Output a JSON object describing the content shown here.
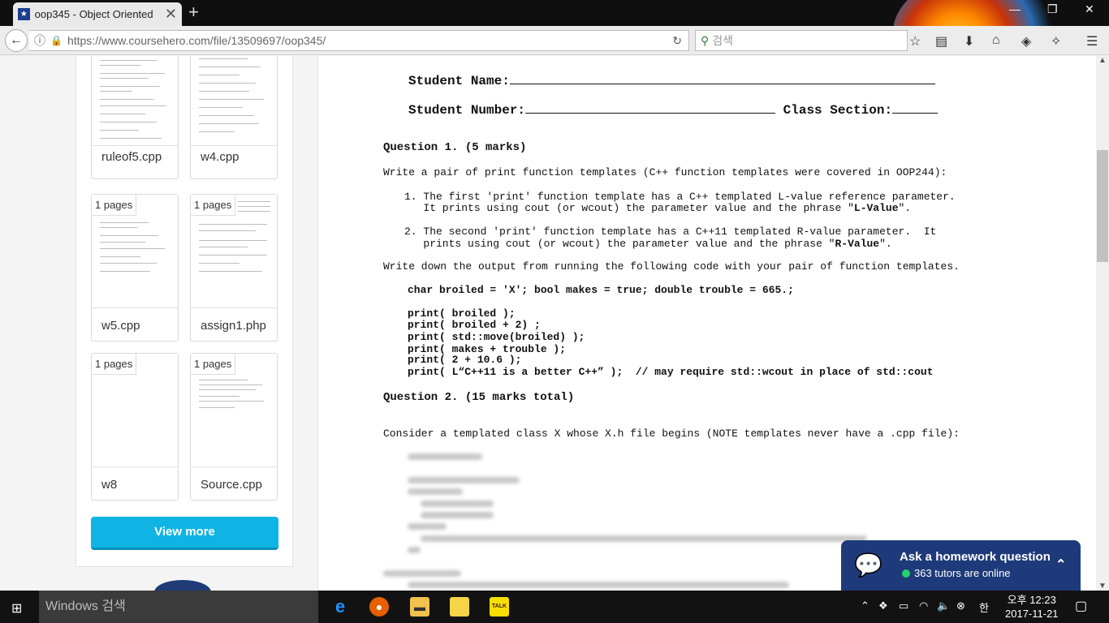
{
  "browser": {
    "tab_title": "oop345 - Object Oriented",
    "url": "https://www.coursehero.com/file/13509697/oop345/",
    "search_placeholder": "검색"
  },
  "sidebar": {
    "cards": [
      {
        "pages": "",
        "name": "ruleof5.cpp"
      },
      {
        "pages": "",
        "name": "w4.cpp"
      },
      {
        "pages": "1 pages",
        "name": "w5.cpp"
      },
      {
        "pages": "1 pages",
        "name": "assign1.php"
      },
      {
        "pages": "1 pages",
        "name": "w8"
      },
      {
        "pages": "1 pages",
        "name": "Source.cpp"
      }
    ],
    "view_more": "View more"
  },
  "document": {
    "student_name": "Student Name:",
    "student_number": "Student Number:",
    "class_section": "Class Section:",
    "q1_heading": "Question 1. (5 marks)",
    "q1_intro": "Write a pair of print function templates (C++ function templates were covered in OOP244):",
    "item1_a": "1. The first 'print' function template has a C++ templated L-value reference parameter.",
    "item1_b": "   It prints using cout (or wcout) the parameter value and the phrase \"",
    "item1_bold": "L-Value",
    "item1_end": "\".",
    "item2_a": "2. The second 'print' function template has a C++11 templated R-value parameter.  It",
    "item2_b": "   prints using cout (or wcout) the parameter value and the phrase \"",
    "item2_bold": "R-Value",
    "item2_end": "\".",
    "write_down": "Write down the output from running the following code with your pair of function templates.",
    "code_decl": "char broiled = 'X'; bool makes = true; double trouble = 665.;",
    "code_lines": [
      "print( broiled );",
      "print( broiled + 2) ;",
      "print( std::move(broiled) );",
      "print( makes + trouble );",
      "print( 2 + 10.6 );",
      "print( L“C++11 is a better C++” );  // may require std::wcout in place of std::cout"
    ],
    "q2_heading": "Question 2. (15 marks total)",
    "q2_intro": "Consider a templated class X whose X.h file begins (NOTE templates never have a .cpp file):"
  },
  "chat": {
    "title": "Ask a homework question",
    "status": "363 tutors are online"
  },
  "taskbar": {
    "search": "Windows 검색",
    "ampm_time": "오후 12:23",
    "date": "2017-11-21"
  },
  "colors": {
    "view_more": "#0fb4e4",
    "chat_bg": "#1f3a7a",
    "online_dot": "#1ed36f"
  }
}
